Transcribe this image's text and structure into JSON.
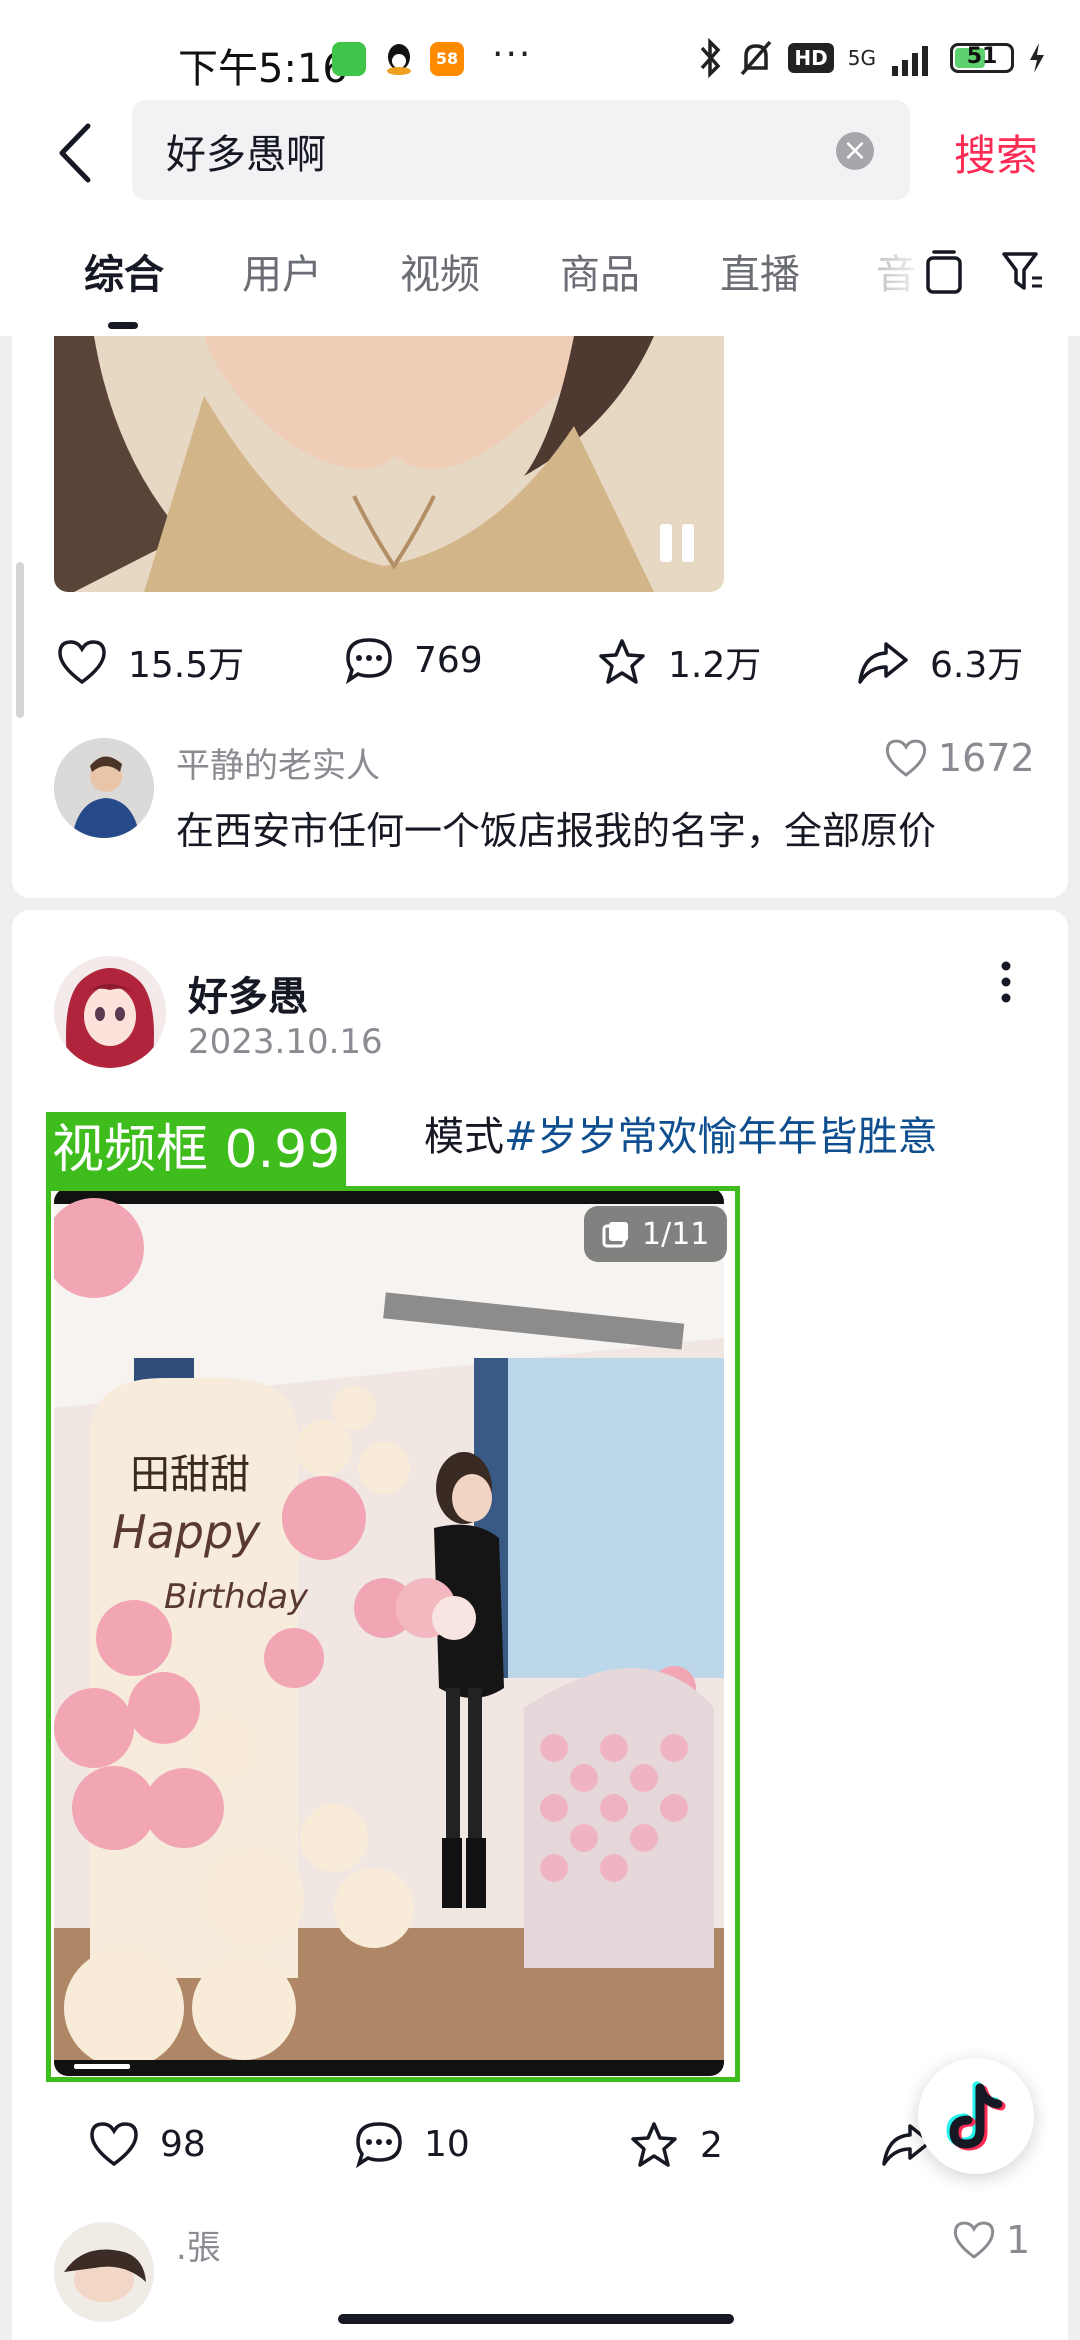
{
  "status_bar": {
    "time": "下午5:16",
    "signal_label": "5G",
    "battery": "51",
    "battery_level": 0.51,
    "more": "···",
    "badge_58": "58"
  },
  "search": {
    "query": "好多愚啊",
    "button_label": "搜索",
    "clear_glyph": "×"
  },
  "tabs": [
    {
      "label": "综合",
      "active": true
    },
    {
      "label": "用户",
      "active": false
    },
    {
      "label": "视频",
      "active": false
    },
    {
      "label": "商品",
      "active": false
    },
    {
      "label": "直播",
      "active": false
    },
    {
      "label": "音",
      "active": false
    }
  ],
  "post1": {
    "likes": "15.5万",
    "comments": "769",
    "favorites": "1.2万",
    "shares": "6.3万",
    "top_comment": {
      "user": "平静的老实人",
      "text": "在西安市任何一个饭店报我的名字，全部原价",
      "likes": "1672"
    }
  },
  "post2": {
    "author": "好多愚",
    "date": "2023.10.16",
    "caption_text": "模式",
    "hashtag": "#岁岁常欢愉年年皆胜意",
    "detect_label": "视频框 0.99",
    "page_indicator": "1/11",
    "image_text": {
      "name": "田甜甜",
      "line1": "Happy",
      "line2": "Birthday"
    },
    "likes": "98",
    "comments": "10",
    "favorites": "2",
    "top_comment": {
      "user": ".張",
      "likes": "1"
    }
  },
  "colors": {
    "accent": "#fe2c55",
    "hashtag": "#0f4f8f",
    "detect": "#3ebd1c"
  },
  "icons": [
    "back-arrow-icon",
    "clear-icon",
    "clipboard-icon",
    "filter-icon",
    "heart-icon",
    "comment-icon",
    "star-icon",
    "share-icon",
    "more-icon",
    "gallery-icon",
    "pause-icon",
    "douyin-logo-icon"
  ]
}
